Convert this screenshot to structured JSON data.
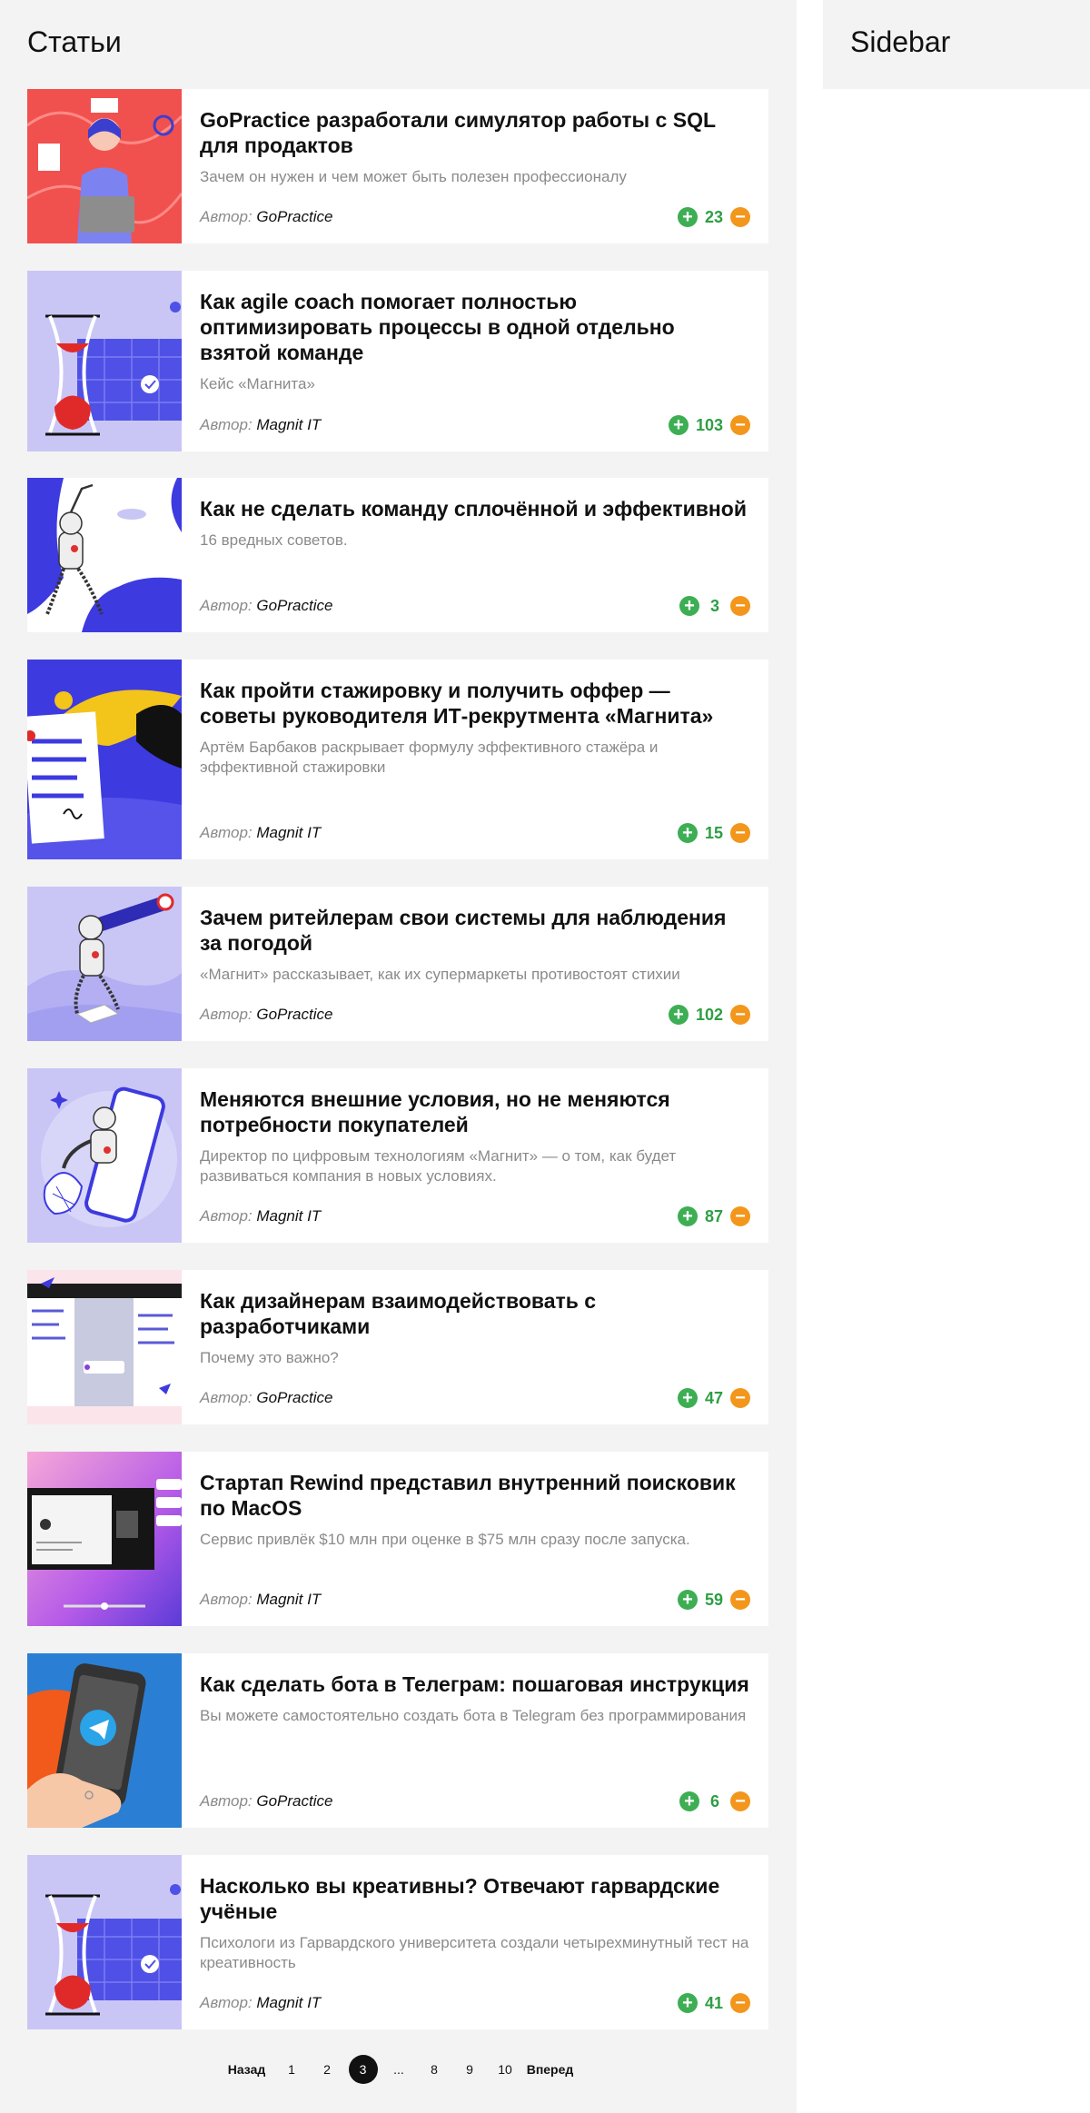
{
  "main": {
    "title": "Статьи"
  },
  "sidebar": {
    "title": "Sidebar"
  },
  "colors": {
    "upvote": "#3dae53",
    "downvote": "#f3961c",
    "score": "#2e9e44",
    "background": "#f3f3f3"
  },
  "articles": [
    {
      "title": "GoPractice разработали симулятор работы с SQL для продактов",
      "description": "Зачем он нужен и чем может быть полезен профессионалу",
      "author_prefix": "Автор:",
      "author": "GoPractice",
      "score": "23",
      "image": "person-with-laptop-illustration"
    },
    {
      "title": "Как agile coach помогает полностью оптимизировать процессы в одной отдельно взятой команде",
      "description": "Кейс «Магнита»",
      "author_prefix": "Автор:",
      "author": "Magnit IT",
      "score": "103",
      "image": "hourglass-calendar-illustration"
    },
    {
      "title": "Как не сделать команду сплочённой и эффективной",
      "description": "16 вредных советов.",
      "author_prefix": "Автор:",
      "author": "GoPractice",
      "score": "3",
      "image": "robot-illustration"
    },
    {
      "title": "Как пройти стажировку и получить оффер — советы руководителя ИТ-рекрутмента «Магнита»",
      "description": "Артём Барбаков раскрывает формулу эффективного стажёра и эффективной стажировки",
      "author_prefix": "Автор:",
      "author": "Magnit IT",
      "score": "15",
      "image": "bird-document-illustration"
    },
    {
      "title": "Зачем ритейлерам свои системы для наблюдения за погодой",
      "description": "«Магнит» рассказывает, как их супермаркеты противостоят стихии",
      "author_prefix": "Автор:",
      "author": "GoPractice",
      "score": "102",
      "image": "robot-telescope-illustration"
    },
    {
      "title": "Меняются внешние условия, но не меняются потребности покупателей",
      "description": "Директор по цифровым технологиям «Магнит» — о том, как будет развиваться компания в новых условиях.",
      "author_prefix": "Автор:",
      "author": "Magnit IT",
      "score": "87",
      "image": "robot-phone-illustration"
    },
    {
      "title": "Как дизайнерам взаимодействовать с разработчиками",
      "description": "Почему это важно?",
      "author_prefix": "Автор:",
      "author": "GoPractice",
      "score": "47",
      "image": "design-mockup-illustration"
    },
    {
      "title": "Стартап Rewind представил внутренний поисковик по MacOS",
      "description": "Сервис привлёк $10 млн при оценке в $75 млн сразу после запуска.",
      "author_prefix": "Автор:",
      "author": "Magnit IT",
      "score": "59",
      "image": "rewind-app-screenshot"
    },
    {
      "title": "Как сделать бота в Телеграм: пошаговая инструкция",
      "description": "Вы можете самостоятельно создать бота в Telegram без программирования",
      "author_prefix": "Автор:",
      "author": "GoPractice",
      "score": "6",
      "image": "telegram-phone-illustration"
    },
    {
      "title": "Насколько вы креативны? Отвечают гарвардские учёные",
      "description": "Психологи из Гарвардского университета создали четырехминутный тест на креативность",
      "author_prefix": "Автор:",
      "author": "Magnit IT",
      "score": "41",
      "image": "hourglass-calendar-illustration"
    }
  ],
  "pagination": {
    "prev": "Назад",
    "next": "Вперед",
    "pages": [
      "1",
      "2",
      "3",
      "...",
      "8",
      "9",
      "10"
    ],
    "current": "3"
  }
}
